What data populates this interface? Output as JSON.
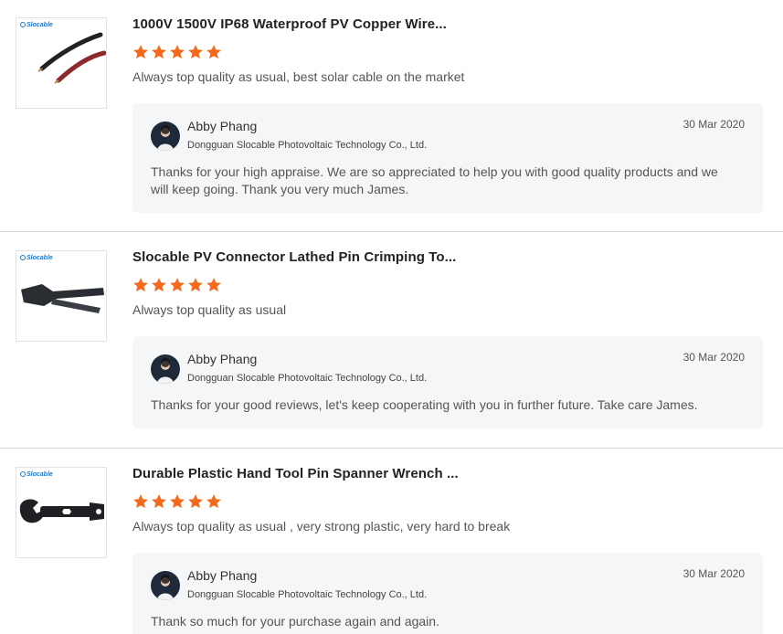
{
  "reviews": [
    {
      "brand": "Slocable",
      "product_icon": "pv-cable-icon",
      "title": "1000V 1500V IP68 Waterproof PV Copper Wire...",
      "rating": 5,
      "comment": "Always top quality as usual, best solar cable on the market",
      "reply": {
        "name": "Abby Phang",
        "company": "Dongguan Slocable Photovoltaic Technology Co., Ltd.",
        "date": "30 Mar 2020",
        "text": "Thanks for your high appraise. We are so appreciated to help you with good quality products and we will keep going. Thank you very much James."
      }
    },
    {
      "brand": "Slocable",
      "product_icon": "crimping-tool-icon",
      "title": "Slocable PV Connector Lathed Pin Crimping To...",
      "rating": 5,
      "comment": "Always top quality as usual",
      "reply": {
        "name": "Abby Phang",
        "company": "Dongguan Slocable Photovoltaic Technology Co., Ltd.",
        "date": "30 Mar 2020",
        "text": "Thanks for your good reviews, let's keep cooperating with you in further future. Take care James."
      }
    },
    {
      "brand": "Slocable",
      "product_icon": "spanner-wrench-icon",
      "title": "Durable Plastic Hand Tool Pin Spanner Wrench ...",
      "rating": 5,
      "comment": "Always top quality as usual , very strong plastic, very hard to break",
      "reply": {
        "name": "Abby Phang",
        "company": "Dongguan Slocable Photovoltaic Technology Co., Ltd.",
        "date": "30 Mar 2020",
        "text": "Thank so much for your purchase again and again."
      }
    }
  ],
  "colors": {
    "star": "#f26b1d",
    "reply_bg": "#f5f6f8",
    "brand": "#1f78c8"
  },
  "icons": {
    "star": "star-icon",
    "avatar": "avatar-image"
  }
}
